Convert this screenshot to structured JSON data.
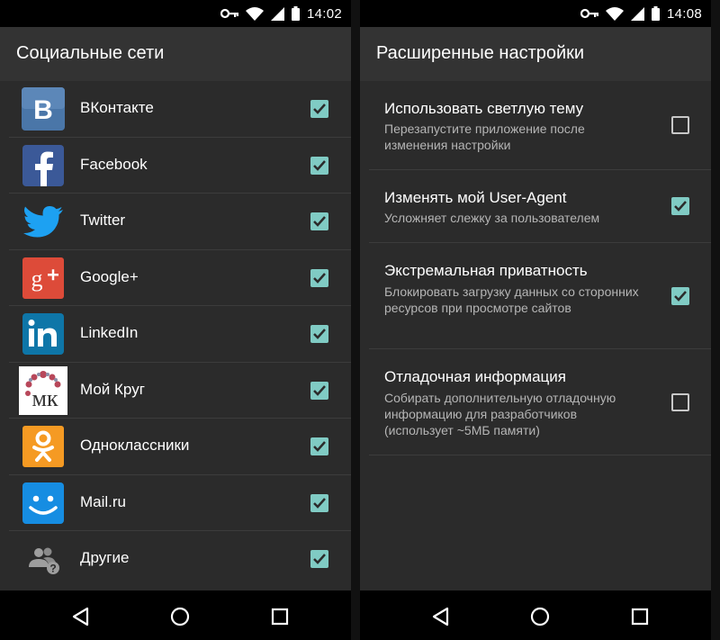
{
  "left": {
    "status_time": "14:02",
    "title": "Социальные сети",
    "networks": [
      {
        "label": "ВКонтакте",
        "icon": "vkontakte-icon",
        "checked": true
      },
      {
        "label": "Facebook",
        "icon": "facebook-icon",
        "checked": true
      },
      {
        "label": "Twitter",
        "icon": "twitter-icon",
        "checked": true
      },
      {
        "label": "Google+",
        "icon": "google-plus-icon",
        "checked": true
      },
      {
        "label": "LinkedIn",
        "icon": "linkedin-icon",
        "checked": true
      },
      {
        "label": "Мой Круг",
        "icon": "moikrug-icon",
        "checked": true,
        "icon_text": "мк"
      },
      {
        "label": "Одноклассники",
        "icon": "odnoklassniki-icon",
        "checked": true
      },
      {
        "label": "Mail.ru",
        "icon": "mailru-icon",
        "checked": true
      },
      {
        "label": "Другие",
        "icon": "others-icon",
        "checked": true
      }
    ]
  },
  "right": {
    "status_time": "14:08",
    "title": "Расширенные настройки",
    "settings": [
      {
        "title": "Использовать светлую тему",
        "description": "Перезапустите приложение после изменения настройки",
        "checked": false
      },
      {
        "title": "Изменять мой User-Agent",
        "description": "Усложняет слежку за пользователем",
        "checked": true
      },
      {
        "title": "Экстремальная приватность",
        "description": "Блокировать загрузку данных со сторонних ресурсов при просмотре сайтов",
        "checked": true
      },
      {
        "title": "Отладочная информация",
        "description": "Собирать дополнительную отладочную информацию для разработчиков (использует ~5МБ памяти)",
        "checked": false
      }
    ]
  },
  "colors": {
    "accent": "#80cbc4",
    "appbar": "#333333",
    "background": "#2b2b2b",
    "vk": "#4a76a8",
    "facebook": "#3b5998",
    "twitter": "#1da1f2",
    "google_plus": "#dd4b39",
    "linkedin": "#0e76a8",
    "odnoklassniki": "#f59a23",
    "mailru": "#168de2"
  },
  "icons": {
    "status": [
      "vpn-key-icon",
      "wifi-icon",
      "signal-icon",
      "battery-icon"
    ],
    "nav": [
      "back-icon",
      "home-icon",
      "recents-icon"
    ]
  }
}
